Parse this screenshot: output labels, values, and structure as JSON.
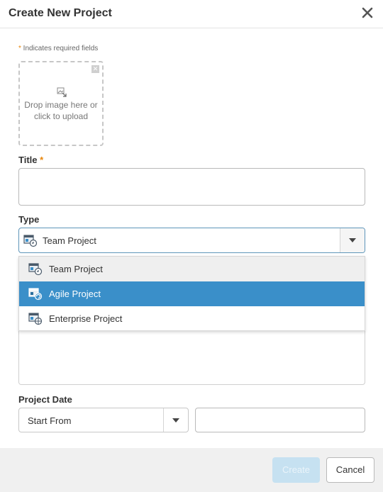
{
  "dialog": {
    "title": "Create New Project",
    "close_icon": "close-icon"
  },
  "form": {
    "required_star": "*",
    "required_note": " Indicates required fields",
    "upload": {
      "text": "Drop image here or\nclick to upload",
      "icon": "image-icon",
      "remove_icon": "remove-icon"
    },
    "title_label": "Title",
    "title_star": "*",
    "title_value": "",
    "type_label": "Type",
    "type_selected": "Team Project",
    "type_icon": "project-icon",
    "type_options": [
      {
        "label": "Team Project",
        "icon": "team-project-icon",
        "state": "hover"
      },
      {
        "label": "Agile Project",
        "icon": "agile-project-icon",
        "state": "selected"
      },
      {
        "label": "Enterprise Project",
        "icon": "enterprise-project-icon",
        "state": "normal"
      }
    ],
    "date_label": "Project Date",
    "date_mode": "Start From",
    "date_value": ""
  },
  "footer": {
    "create_label": "Create",
    "cancel_label": "Cancel"
  },
  "colors": {
    "accent": "#3a8fc9",
    "required": "#e8860c",
    "disabled_button": "#c6e1f1"
  }
}
